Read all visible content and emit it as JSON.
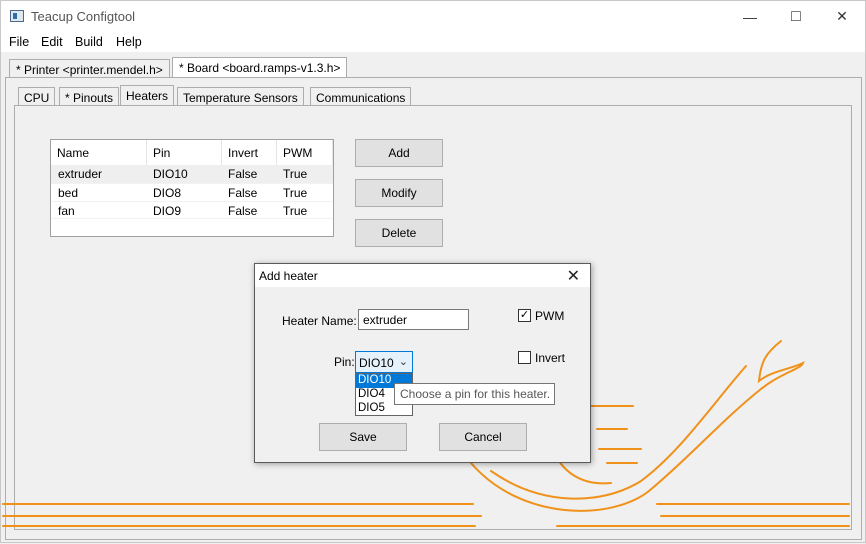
{
  "window": {
    "title": "Teacup Configtool",
    "controls": {
      "minimize": "—",
      "maximize": "□",
      "close": "✕"
    }
  },
  "menu": {
    "items": [
      "File",
      "Edit",
      "Build",
      "Help"
    ]
  },
  "top_tabs": [
    {
      "label": "* Printer <printer.mendel.h>",
      "active": false
    },
    {
      "label": "* Board <board.ramps-v1.3.h>",
      "active": true
    }
  ],
  "sub_tabs": [
    {
      "label": "CPU",
      "active": false
    },
    {
      "label": "* Pinouts",
      "active": false
    },
    {
      "label": "Heaters",
      "active": true
    },
    {
      "label": "Temperature Sensors",
      "active": false
    },
    {
      "label": "Communications",
      "active": false
    }
  ],
  "heater_table": {
    "columns": [
      "Name",
      "Pin",
      "Invert",
      "PWM"
    ],
    "rows": [
      [
        "extruder",
        "DIO10",
        "False",
        "True"
      ],
      [
        "bed",
        "DIO8",
        "False",
        "True"
      ],
      [
        "fan",
        "DIO9",
        "False",
        "True"
      ]
    ],
    "selected_row": 0
  },
  "buttons": {
    "add": "Add",
    "modify": "Modify",
    "delete": "Delete"
  },
  "dialog": {
    "title": "Add heater",
    "close": "✕",
    "heater_name_label": "Heater Name:",
    "heater_name_value": "extruder",
    "pin_label": "Pin:",
    "pin_selected": "DIO10",
    "pin_options": [
      "DIO10",
      "DIO4",
      "DIO5"
    ],
    "pwm_label": "PWM",
    "pwm_checked": true,
    "invert_label": "Invert",
    "invert_checked": false,
    "tooltip": "Choose a pin for this heater.",
    "save_label": "Save",
    "cancel_label": "Cancel"
  },
  "colors": {
    "accent": "#0078d7",
    "artwork": "#f0911a"
  }
}
